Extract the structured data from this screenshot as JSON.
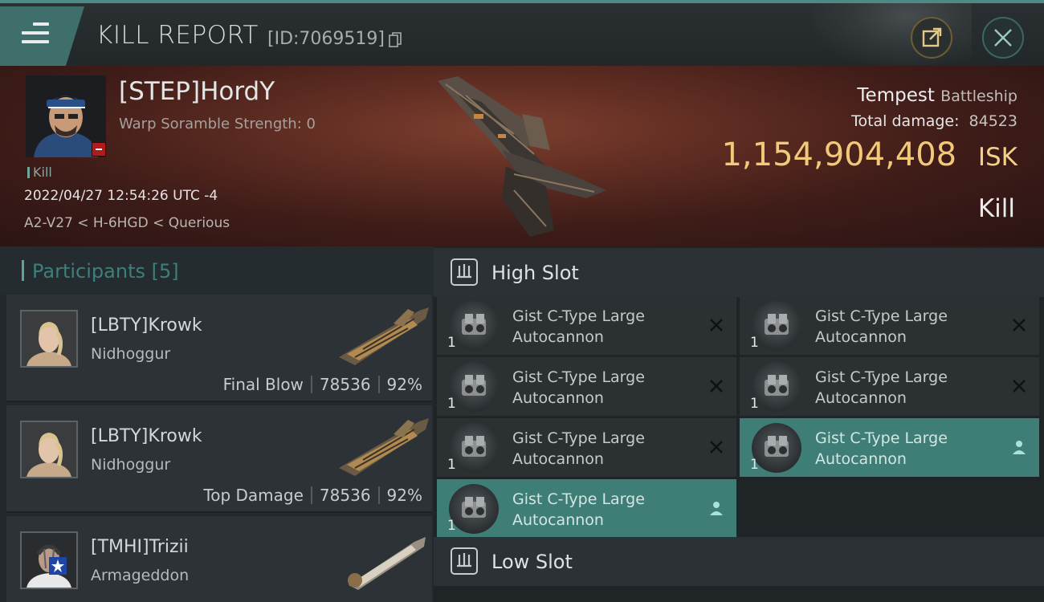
{
  "header": {
    "title": "KILL REPORT",
    "report_id": "[ID:7069519]",
    "menu_icon": "hamburger-menu-icon",
    "share_icon": "share-external-icon",
    "close_icon": "close-icon"
  },
  "victim": {
    "name": "[STEP]HordY",
    "warp_scramble": "Warp Soramble Strength: 0",
    "result_tag": "Kill",
    "datetime": "2022/04/27 12:54:26 UTC -4",
    "location": "A2-V27 < H-6HGD < Querious",
    "ship_name": "Tempest",
    "ship_class": "Battleship",
    "total_damage_label": "Total damage:",
    "total_damage": "84523",
    "isk_value": "1,154,904,408",
    "isk_unit": "ISK",
    "result": "Kill"
  },
  "participants": {
    "title": "Participants [5]",
    "rows": [
      {
        "name": "[LBTY]Krowk",
        "ship": "Nidhoggur",
        "role": "Final Blow",
        "damage": "78536",
        "percent": "92%"
      },
      {
        "name": "[LBTY]Krowk",
        "ship": "Nidhoggur",
        "role": "Top Damage",
        "damage": "78536",
        "percent": "92%"
      },
      {
        "name": "[TMHI]Trizii",
        "ship": "Armageddon",
        "role": "",
        "damage": "",
        "percent": ""
      }
    ]
  },
  "fitting": {
    "high_slot_label": "High Slot",
    "low_slot_label": "Low Slot",
    "high_modules": [
      {
        "name": "Gist C-Type Large Autocannon",
        "qty": "1",
        "status": "destroyed"
      },
      {
        "name": "Gist C-Type Large Autocannon",
        "qty": "1",
        "status": "destroyed"
      },
      {
        "name": "Gist C-Type Large Autocannon",
        "qty": "1",
        "status": "destroyed"
      },
      {
        "name": "Gist C-Type Large Autocannon",
        "qty": "1",
        "status": "destroyed"
      },
      {
        "name": "Gist C-Type Large Autocannon",
        "qty": "1",
        "status": "destroyed"
      },
      {
        "name": "Gist C-Type Large Autocannon",
        "qty": "1",
        "status": "dropped"
      },
      {
        "name": "Gist C-Type Large Autocannon",
        "qty": "1",
        "status": "dropped"
      }
    ]
  },
  "colors": {
    "accent_teal": "#3f7e77",
    "isk_gold": "#f2c978",
    "banner_red": "#5e2c22"
  }
}
